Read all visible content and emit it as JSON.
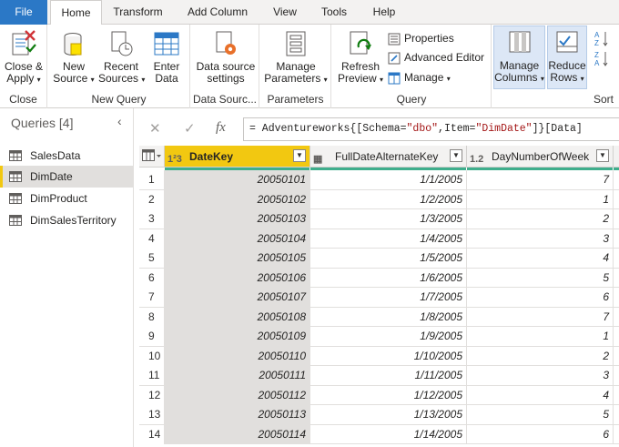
{
  "tabs": [
    {
      "label": "File"
    },
    {
      "label": "Home"
    },
    {
      "label": "Transform"
    },
    {
      "label": "Add Column"
    },
    {
      "label": "View"
    },
    {
      "label": "Tools"
    },
    {
      "label": "Help"
    }
  ],
  "ribbon": {
    "close": {
      "line1": "Close &",
      "line2": "Apply",
      "group": "Close"
    },
    "new_query": {
      "new_source": {
        "line1": "New",
        "line2": "Source"
      },
      "recent_sources": {
        "line1": "Recent",
        "line2": "Sources"
      },
      "enter_data": {
        "line1": "Enter",
        "line2": "Data"
      },
      "group": "New Query"
    },
    "data_sources": {
      "line1": "Data source",
      "line2": "settings",
      "group": "Data Sourc..."
    },
    "parameters": {
      "line1": "Manage",
      "line2": "Parameters",
      "group": "Parameters"
    },
    "query": {
      "refresh": {
        "line1": "Refresh",
        "line2": "Preview"
      },
      "properties": "Properties",
      "advanced_editor": "Advanced Editor",
      "manage": "Manage",
      "group": "Query"
    },
    "manage_columns": {
      "line1": "Manage",
      "line2": "Columns"
    },
    "reduce_rows": {
      "line1": "Reduce",
      "line2": "Rows"
    },
    "sort": {
      "group": "Sort"
    }
  },
  "queries_pane": {
    "title": "Queries [4]",
    "collapse_glyph": "‹",
    "items": [
      {
        "label": "SalesData"
      },
      {
        "label": "DimDate",
        "selected": true
      },
      {
        "label": "DimProduct"
      },
      {
        "label": "DimSalesTerritory"
      }
    ]
  },
  "formula_bar": {
    "cancel_glyph": "✕",
    "commit_glyph": "✓",
    "fx_label": "fx",
    "prefix": "= Adventureworks{[Schema=",
    "schema": "\"dbo\"",
    "mid": ",Item=",
    "item": "\"DimDate\"",
    "suffix": "]}[Data]"
  },
  "grid": {
    "columns": [
      {
        "type_icon": "1²3",
        "name": "DateKey"
      },
      {
        "type_icon": "▦",
        "name": "FullDateAlternateKey"
      },
      {
        "type_icon": "1.2",
        "name": "DayNumberOfWeek"
      }
    ],
    "rows": [
      {
        "n": "1",
        "date_key": "20050101",
        "full_date": "1/1/2005",
        "day_of_week": "7"
      },
      {
        "n": "2",
        "date_key": "20050102",
        "full_date": "1/2/2005",
        "day_of_week": "1"
      },
      {
        "n": "3",
        "date_key": "20050103",
        "full_date": "1/3/2005",
        "day_of_week": "2"
      },
      {
        "n": "4",
        "date_key": "20050104",
        "full_date": "1/4/2005",
        "day_of_week": "3"
      },
      {
        "n": "5",
        "date_key": "20050105",
        "full_date": "1/5/2005",
        "day_of_week": "4"
      },
      {
        "n": "6",
        "date_key": "20050106",
        "full_date": "1/6/2005",
        "day_of_week": "5"
      },
      {
        "n": "7",
        "date_key": "20050107",
        "full_date": "1/7/2005",
        "day_of_week": "6"
      },
      {
        "n": "8",
        "date_key": "20050108",
        "full_date": "1/8/2005",
        "day_of_week": "7"
      },
      {
        "n": "9",
        "date_key": "20050109",
        "full_date": "1/9/2005",
        "day_of_week": "1"
      },
      {
        "n": "10",
        "date_key": "20050110",
        "full_date": "1/10/2005",
        "day_of_week": "2"
      },
      {
        "n": "11",
        "date_key": "20050111",
        "full_date": "1/11/2005",
        "day_of_week": "3"
      },
      {
        "n": "12",
        "date_key": "20050112",
        "full_date": "1/12/2005",
        "day_of_week": "4"
      },
      {
        "n": "13",
        "date_key": "20050113",
        "full_date": "1/13/2005",
        "day_of_week": "5"
      },
      {
        "n": "14",
        "date_key": "20050114",
        "full_date": "1/14/2005",
        "day_of_week": "6"
      }
    ]
  },
  "colors": {
    "file_tab": "#2b78c6",
    "key_column_header": "#f2c811",
    "column_quality_bar": "#3fae8c",
    "selected_query_marker": "#f2c811"
  }
}
